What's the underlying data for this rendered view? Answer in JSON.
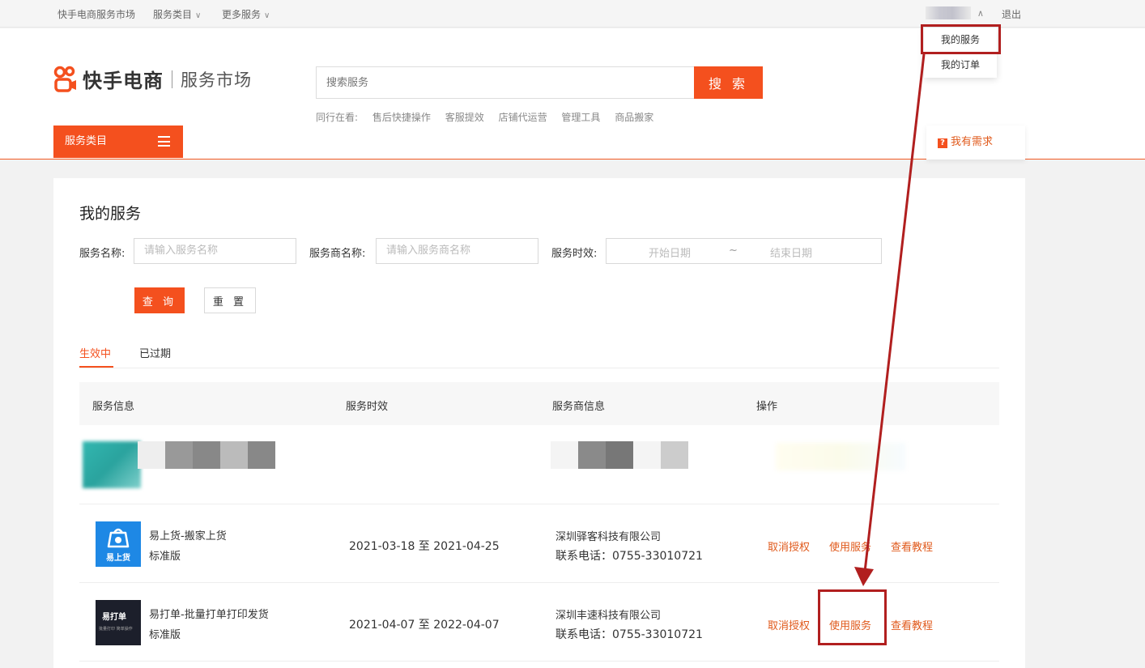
{
  "topbar": {
    "site_link": "快手电商服务市场",
    "service_category": "服务类目",
    "more_services": "更多服务",
    "user_name": "",
    "logout": "退出"
  },
  "user_menu": {
    "my_services": "我的服务",
    "my_orders": "我的订单"
  },
  "header": {
    "logo_text": "快手电商",
    "logo_sub": "服务市场",
    "search_placeholder": "搜索服务",
    "search_button": "搜 索",
    "hot_prefix": "同行在看:",
    "hot_items": [
      "售后快捷操作",
      "客服提效",
      "店铺代运营",
      "管理工具",
      "商品搬家"
    ],
    "category_button": "服务类目",
    "need_button": "我有需求",
    "need_icon_glyph": "?"
  },
  "main": {
    "title": "我的服务",
    "filters": {
      "service_name_label": "服务名称:",
      "service_name_placeholder": "请输入服务名称",
      "provider_name_label": "服务商名称:",
      "provider_name_placeholder": "请输入服务商名称",
      "validity_label": "服务时效:",
      "start_date": "开始日期",
      "date_sep": "~",
      "end_date": "结束日期"
    },
    "query_button": "查 询",
    "reset_button": "重 置",
    "tabs": [
      {
        "label": "生效中",
        "active": true
      },
      {
        "label": "已过期",
        "active": false
      }
    ],
    "table": {
      "headers": [
        "服务信息",
        "服务时效",
        "服务商信息",
        "操作"
      ],
      "rows": [
        {
          "name": "易上货-搬家上货",
          "version": "标准版",
          "thumb_label": "易上货",
          "period": "2021-03-18 至 2021-04-25",
          "company": "深圳驿客科技有限公司",
          "phone": "联系电话：0755-33010721",
          "actions": [
            "取消授权",
            "使用服务",
            "查看教程"
          ]
        },
        {
          "name": "易打单-批量打单打印发货",
          "version": "标准版",
          "thumb_label": "易打单",
          "thumb_sub": "批量打印 简单操作",
          "period": "2021-04-07 至 2022-04-07",
          "company": "深圳丰速科技有限公司",
          "phone": "联系电话：0755-33010721",
          "actions": [
            "取消授权",
            "使用服务",
            "查看教程"
          ]
        }
      ]
    }
  },
  "colors": {
    "accent": "#f4501e",
    "link": "#e05a1c",
    "annotation": "#b11f1f"
  }
}
